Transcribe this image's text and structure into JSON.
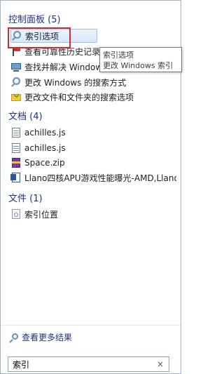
{
  "sections": {
    "control_panel": {
      "header": "控制面板 (5)",
      "items": [
        {
          "label": "索引选项",
          "icon": "search-index-icon"
        },
        {
          "label": "查看可靠性历史记录",
          "icon": "flag-icon"
        },
        {
          "label": "查找并解决 Windows 问题",
          "icon": "computer-icon"
        },
        {
          "label": "更改 Windows 的搜索方式",
          "icon": "search-user-icon"
        },
        {
          "label": "更改文件和文件夹的搜索选项",
          "icon": "folder-check-icon"
        }
      ]
    },
    "documents": {
      "header": "文档 (4)",
      "items": [
        {
          "label": "achilles.js",
          "icon": "script-file-icon"
        },
        {
          "label": "achilles.js",
          "icon": "script-file-icon"
        },
        {
          "label": "Space.zip",
          "icon": "zip-archive-icon"
        },
        {
          "label": "Llano四核APU游戏性能曝光-AMD,Llano",
          "icon": "word-document-icon"
        }
      ]
    },
    "files": {
      "header": "文件 (1)",
      "items": [
        {
          "label": "索引位置",
          "icon": "generic-file-icon"
        }
      ]
    }
  },
  "tooltip": {
    "title": "索引选项",
    "description": "更改 Windows 索引"
  },
  "see_more": "查看更多结果",
  "search": {
    "value": "索引",
    "clear_symbol": "×"
  },
  "colors": {
    "header_text": "#1e3287",
    "selection": "#d6e8fb",
    "highlight_box": "#e0242a"
  }
}
